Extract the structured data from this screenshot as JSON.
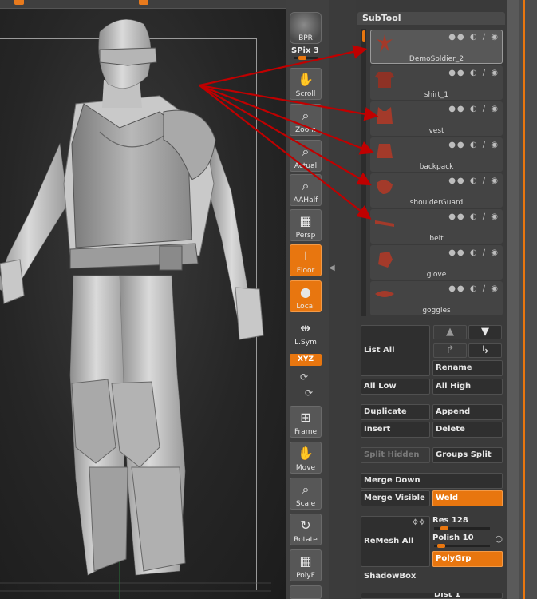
{
  "shelf": {
    "bpr_label": "BPR",
    "spix_label": "SPix 3",
    "buttons": [
      {
        "label": "Scroll",
        "icon": "hand-icon"
      },
      {
        "label": "Zoom",
        "icon": "magnifier-icon"
      },
      {
        "label": "Actual",
        "icon": "magnifier-icon"
      },
      {
        "label": "AAHalf",
        "icon": "magnifier-icon"
      },
      {
        "label": "Persp",
        "icon": "grid-icon"
      },
      {
        "label": "Floor",
        "icon": "floor-icon"
      },
      {
        "label": "Local",
        "icon": "local-icon"
      },
      {
        "label": "L.Sym",
        "icon": "arrows-icon"
      },
      {
        "label": "Frame",
        "icon": "frame-icon"
      },
      {
        "label": "Move",
        "icon": "hand-icon"
      },
      {
        "label": "Scale",
        "icon": "magnifier-icon"
      },
      {
        "label": "Rotate",
        "icon": "rotate-icon"
      },
      {
        "label": "PolyF",
        "icon": "polyframe-icon"
      }
    ],
    "xyz_label": "XYZ"
  },
  "subtool": {
    "title": "SubTool",
    "items": [
      {
        "name": "DemoSoldier_2",
        "selected": true
      },
      {
        "name": "shirt_1",
        "selected": false
      },
      {
        "name": "vest",
        "selected": false
      },
      {
        "name": "backpack",
        "selected": false
      },
      {
        "name": "shoulderGuard",
        "selected": false
      },
      {
        "name": "belt",
        "selected": false
      },
      {
        "name": "glove",
        "selected": false
      },
      {
        "name": "goggles",
        "selected": false
      }
    ],
    "list_all": "List All",
    "rename": "Rename",
    "all_low": "All Low",
    "all_high": "All High",
    "duplicate": "Duplicate",
    "append": "Append",
    "insert": "Insert",
    "delete": "Delete",
    "split_hidden": "Split Hidden",
    "groups_split": "Groups Split",
    "merge_down": "Merge Down",
    "merge_visible": "Merge Visible",
    "weld": "Weld",
    "remesh_all": "ReMesh All",
    "res_label": "Res 128",
    "polish_label": "Polish 10",
    "polygrp": "PolyGrp",
    "shadowbox": "ShadowBox",
    "dist_label": "Dist 1"
  },
  "colors": {
    "accent": "#e8760f",
    "arrow": "#c00000",
    "subtool_thumb": "#a33a2a"
  }
}
